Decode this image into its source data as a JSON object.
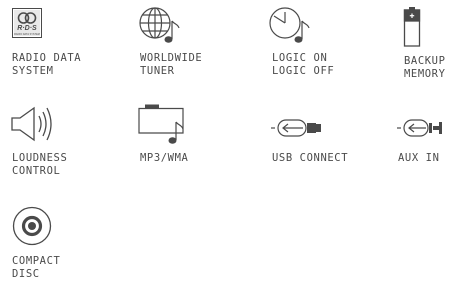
{
  "colors": {
    "stroke": "#4a4a4a",
    "text": "#4a4a4a",
    "background": "#ffffff"
  },
  "features": [
    {
      "icon": "rds-logo-icon",
      "label": [
        "RADIO DATA",
        "SYSTEM"
      ],
      "logo_text": "R·D·S",
      "logo_subtext": "RADIO DATA SYSTEM"
    },
    {
      "icon": "globe-note-icon",
      "label": [
        "WORLDWIDE",
        "TUNER"
      ]
    },
    {
      "icon": "clock-note-icon",
      "label": [
        "LOGIC ON",
        "LOGIC OFF"
      ]
    },
    {
      "icon": "battery-icon",
      "label": [
        "BACKUP",
        "MEMORY"
      ]
    },
    {
      "icon": "speaker-icon",
      "label": [
        "LOUDNESS",
        "CONTROL"
      ]
    },
    {
      "icon": "folder-note-icon",
      "label": [
        "MP3/WMA"
      ]
    },
    {
      "icon": "usb-icon",
      "label": [
        "USB CONNECT"
      ]
    },
    {
      "icon": "aux-jack-icon",
      "label": [
        "AUX IN"
      ]
    },
    {
      "icon": "disc-icon",
      "label": [
        "COMPACT",
        "DISC"
      ]
    }
  ]
}
